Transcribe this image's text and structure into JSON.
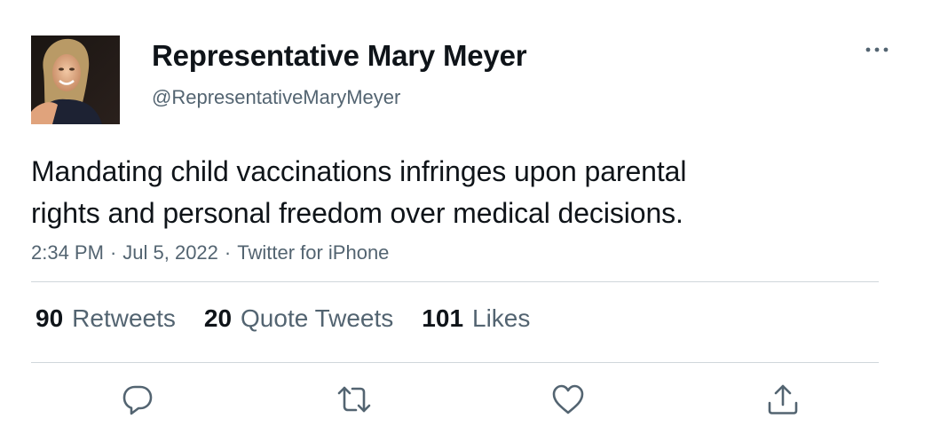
{
  "author": {
    "display_name": "Representative Mary Meyer",
    "handle": "@RepresentativeMaryMeyer",
    "avatar_icon": "profile-photo"
  },
  "tweet": {
    "text_lines": [
      "Mandating child vaccinations infringes upon parental",
      "rights and personal freedom over medical decisions."
    ],
    "time": "2:34 PM",
    "date": "Jul 5, 2022",
    "source": "Twitter for iPhone",
    "separator": "·"
  },
  "stats": {
    "retweets": {
      "count": "90",
      "label": "Retweets"
    },
    "quote_tweets": {
      "count": "20",
      "label": "Quote Tweets"
    },
    "likes": {
      "count": "101",
      "label": "Likes"
    }
  },
  "actions": {
    "reply_icon": "reply-icon",
    "retweet_icon": "retweet-icon",
    "like_icon": "heart-icon",
    "share_icon": "share-icon"
  },
  "menu": {
    "more_icon": "more-options-icon"
  },
  "colors": {
    "text_primary": "#0f1419",
    "text_secondary": "#536471",
    "divider": "#d0d6db"
  }
}
